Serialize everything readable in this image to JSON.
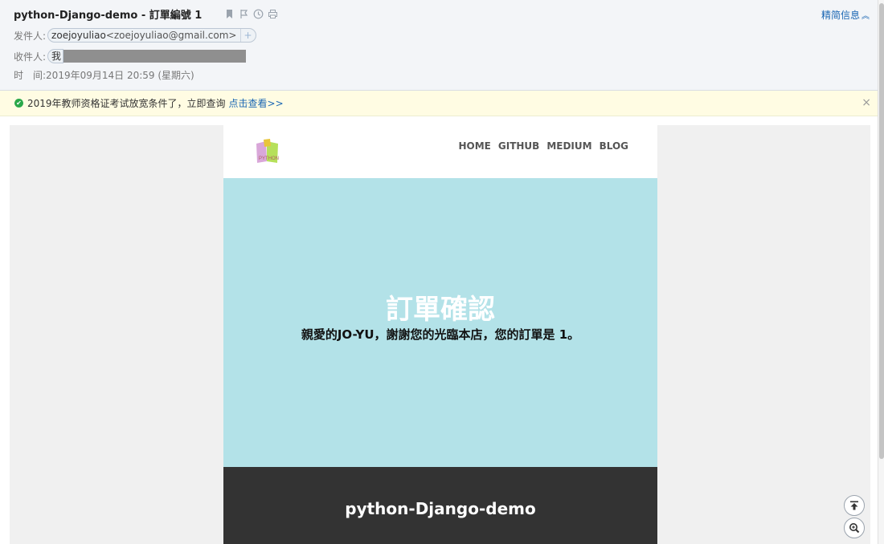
{
  "subject": "python-Django-demo - 訂單編號 1",
  "simple_info_label": "精简信息",
  "sender": {
    "label": "发件人:",
    "name": "zoejoyuliao",
    "email": "<zoejoyuliao@gmail.com>",
    "add": "+"
  },
  "recipient": {
    "label": "收件人:",
    "name": "我"
  },
  "time": {
    "label": "时　间:",
    "value": "2019年09月14日 20:59 (星期六)"
  },
  "notice": {
    "text": "2019年教师资格证考试放宽条件了，立即查询",
    "link": "点击查看>>",
    "close": "×"
  },
  "email": {
    "nav": [
      "HOME",
      "GITHUB",
      "MEDIUM",
      "BLOG"
    ],
    "hero_title": "訂單確認",
    "hero_text": "親愛的JO-YU，謝謝您的光臨本店，您的訂單是 1。",
    "footer_title": "python-Django-demo",
    "logo_text": "PYTHON"
  },
  "colors": {
    "hero_bg": "#b3e2e8",
    "footer_bg": "#333333",
    "link": "#1a66b3",
    "notice_bg": "#fffce3"
  }
}
